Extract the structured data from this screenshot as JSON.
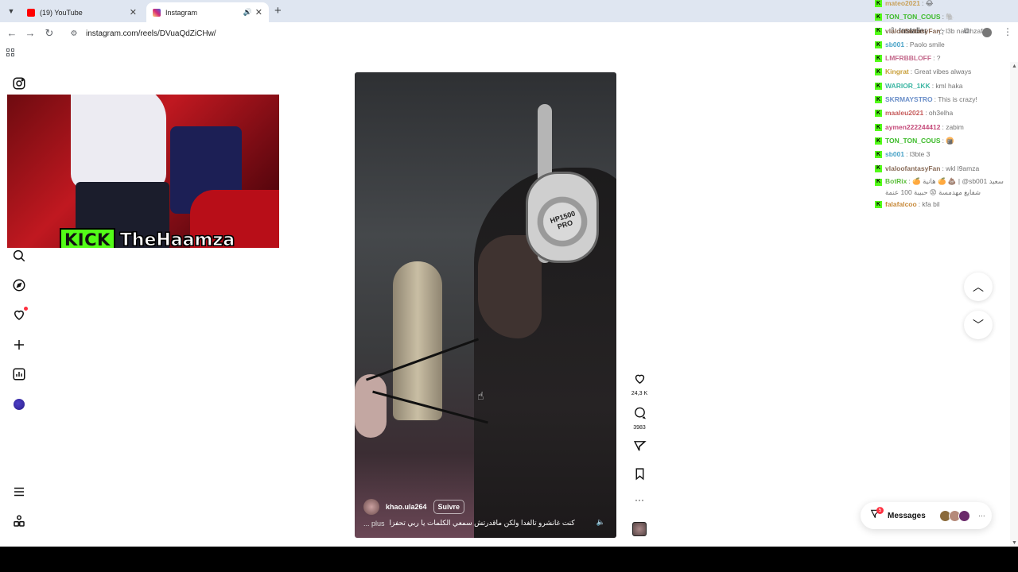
{
  "browser": {
    "tabs": [
      {
        "title": "(19) YouTube",
        "favicon": "youtube-icon",
        "color": "#ff0000",
        "active": false
      },
      {
        "title": "Instagram",
        "favicon": "instagram-icon",
        "color": "#e1306c",
        "active": true
      }
    ],
    "url": "instagram.com/reels/DVuaQdZiCHw/",
    "install_label": "Installer"
  },
  "stream_overlay": {
    "platform_logo": "KICK",
    "streamer": "TheHaamza",
    "accent": "#53fc18"
  },
  "reel": {
    "author": "khao.ula264",
    "follow_label": "Suivre",
    "caption": "كنت غانشرو تالغدا ولكن ماقدرتش سمعي الكلمات يا ربي تحفزا",
    "more_label": "... plus",
    "headphone_label": "HP1500 PRO",
    "likes": "24,3 K",
    "comments": "3983"
  },
  "chat": [
    {
      "user": "mateo2021",
      "msg": ": 😂",
      "color": "#c8a15a"
    },
    {
      "user": "TON_TON_COUS",
      "msg": ": 🐘",
      "color": "#3dbb2a"
    },
    {
      "user": "vlaloofantasyFan",
      "msg": ": l3b nari hzaf",
      "color": "#8a6d5a"
    },
    {
      "user": "sb001",
      "msg": ": Paolo smile",
      "color": "#4aa3c7"
    },
    {
      "user": "LMFRBBLOFF",
      "msg": ": ?",
      "color": "#c46a8c"
    },
    {
      "user": "Kingrat",
      "msg": ": Great vibes always",
      "color": "#c9a03a"
    },
    {
      "user": "WARIOR_1KK",
      "msg": ": kml haka",
      "color": "#3db6a3"
    },
    {
      "user": "SKRMAYSTRO",
      "msg": ": This is crazy!",
      "color": "#6b8fc9"
    },
    {
      "user": "maaleu2021",
      "msg": ": oh3elha",
      "color": "#c65c5c"
    },
    {
      "user": "aymen222244412",
      "msg": ": zabim",
      "color": "#c54a7a"
    },
    {
      "user": "TON_TON_COUS",
      "msg": ": 🍘",
      "color": "#3dbb2a"
    },
    {
      "user": "sb001",
      "msg": ": l3bte 3",
      "color": "#4aa3c7"
    },
    {
      "user": "vlaloofantasyFan",
      "msg": ": wkl l9amza",
      "color": "#8a6d5a"
    },
    {
      "user": "BotRix",
      "msg": ": 🍊 هانية 🍊 💩 | @sb001 سعيد شفايغ مهدمسة 😡 حبيبة 100 عنمة",
      "color": "#5bbf3b",
      "twoline": true
    },
    {
      "user": "falafalcoo",
      "msg": ": kfa bil",
      "color": "#c78a3b"
    }
  ],
  "messages": {
    "label": "Messages",
    "badge": "5",
    "avatar_colors": [
      "#8a6a3a",
      "#b58a7a",
      "#6a2a6a"
    ]
  },
  "colors": {
    "instagram_dot": "#ff3040",
    "kick_green": "#53fc18"
  }
}
